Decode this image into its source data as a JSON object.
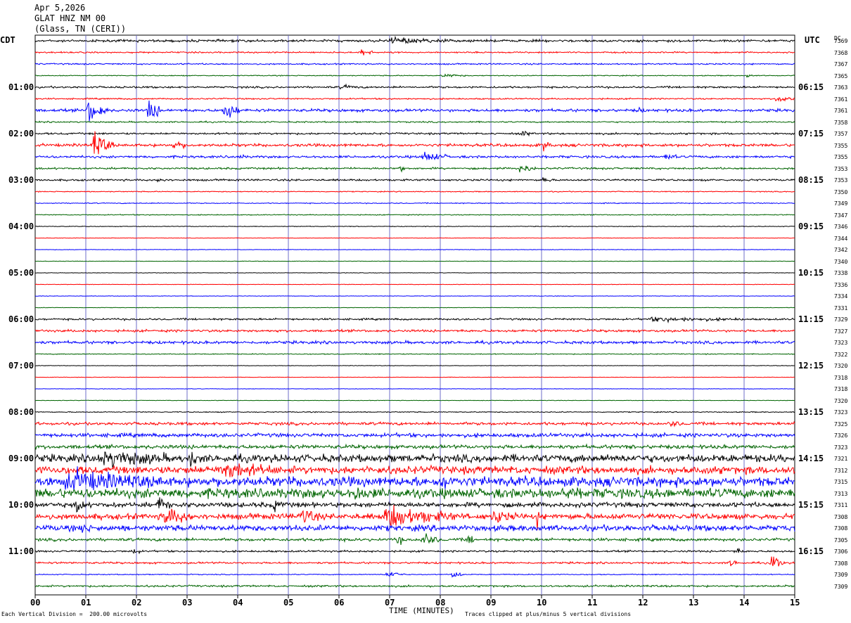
{
  "header": {
    "date": "Apr 5,2026",
    "station": "GLAT HNZ NM 00",
    "location": "(Glass, TN (CERI))"
  },
  "left_zone": "CDT",
  "right_zone": "UTC",
  "dc_label": "DC",
  "footer": {
    "scale_note": "Each Vertical Division =  200.00 microvolts",
    "xlabel": "TIME (MINUTES)",
    "clip_note": "Traces clipped at plus/minus 5 vertical divisions"
  },
  "colors": {
    "trace_cycle": [
      "#000000",
      "#ff0000",
      "#0000ff",
      "#006400"
    ],
    "grid": "#6e6ec8",
    "axis": "#000000"
  },
  "chart_data": {
    "type": "line",
    "title": "",
    "xlabel": "TIME (MINUTES)",
    "ylabel": "",
    "xlim": [
      0,
      15
    ],
    "x_ticks": [
      "00",
      "01",
      "02",
      "03",
      "04",
      "05",
      "06",
      "07",
      "08",
      "09",
      "10",
      "11",
      "12",
      "13",
      "14",
      "15"
    ],
    "trace_count": 48,
    "trace_duration_minutes": 15,
    "left_time_labels": [
      "01:00",
      "02:00",
      "03:00",
      "04:00",
      "05:00",
      "06:00",
      "07:00",
      "08:00",
      "09:00",
      "10:00",
      "11:00"
    ],
    "right_time_labels": [
      "06:15",
      "07:15",
      "08:15",
      "09:15",
      "10:15",
      "11:15",
      "12:15",
      "13:15",
      "14:15",
      "15:15",
      "16:15"
    ],
    "dc_offsets": [
      7369,
      7368,
      7367,
      7365,
      7363,
      7361,
      7361,
      7358,
      7357,
      7355,
      7355,
      7353,
      7353,
      7350,
      7349,
      7347,
      7346,
      7344,
      7342,
      7340,
      7338,
      7336,
      7334,
      7331,
      7329,
      7327,
      7323,
      7322,
      7320,
      7318,
      7318,
      7320,
      7323,
      7325,
      7326,
      7323,
      7321,
      7312,
      7315,
      7313,
      7311,
      7308,
      7308,
      7305,
      7306,
      7308,
      7309,
      7309
    ],
    "noise_level": [
      2.5,
      1.5,
      1.5,
      1,
      2,
      1.5,
      3,
      1.5,
      2,
      3,
      2.5,
      2,
      2,
      1,
      1,
      1,
      0.7,
      0.5,
      0.5,
      0.5,
      0.5,
      0.5,
      0.5,
      0.5,
      2,
      2.5,
      3,
      1,
      0.5,
      0.5,
      0.5,
      0.5,
      1,
      3,
      4,
      4,
      8,
      8,
      10,
      10,
      5,
      6,
      6,
      3,
      2,
      2,
      1,
      2
    ],
    "events": [
      {
        "trace": 0,
        "start": 6.9,
        "end": 8.2,
        "amp": 6
      },
      {
        "trace": 1,
        "start": 6.4,
        "end": 6.7,
        "amp": 8
      },
      {
        "trace": 3,
        "start": 8.0,
        "end": 8.5,
        "amp": 4
      },
      {
        "trace": 3,
        "start": 14.0,
        "end": 14.2,
        "amp": 5
      },
      {
        "trace": 4,
        "start": 6.0,
        "end": 6.4,
        "amp": 4
      },
      {
        "trace": 5,
        "start": 14.6,
        "end": 15.0,
        "amp": 10
      },
      {
        "trace": 6,
        "start": 1.0,
        "end": 1.45,
        "amp": 26
      },
      {
        "trace": 6,
        "start": 2.2,
        "end": 2.5,
        "amp": 28
      },
      {
        "trace": 6,
        "start": 3.7,
        "end": 4.05,
        "amp": 24
      },
      {
        "trace": 6,
        "start": 11.9,
        "end": 12.0,
        "amp": 10
      },
      {
        "trace": 8,
        "start": 9.6,
        "end": 9.8,
        "amp": 6
      },
      {
        "trace": 9,
        "start": 1.1,
        "end": 1.55,
        "amp": 30
      },
      {
        "trace": 9,
        "start": 2.7,
        "end": 3.0,
        "amp": 10
      },
      {
        "trace": 9,
        "start": 10.0,
        "end": 10.2,
        "amp": 12
      },
      {
        "trace": 10,
        "start": 4.0,
        "end": 4.15,
        "amp": 6
      },
      {
        "trace": 10,
        "start": 7.6,
        "end": 8.2,
        "amp": 10
      },
      {
        "trace": 10,
        "start": 12.4,
        "end": 12.7,
        "amp": 6
      },
      {
        "trace": 11,
        "start": 7.2,
        "end": 7.3,
        "amp": 16
      },
      {
        "trace": 11,
        "start": 9.5,
        "end": 9.9,
        "amp": 10
      },
      {
        "trace": 12,
        "start": 2.4,
        "end": 2.6,
        "amp": 6
      },
      {
        "trace": 12,
        "start": 10.0,
        "end": 10.2,
        "amp": 8
      },
      {
        "trace": 24,
        "start": 12.0,
        "end": 14.0,
        "amp": 4
      },
      {
        "trace": 33,
        "start": 12.5,
        "end": 12.8,
        "amp": 6
      },
      {
        "trace": 36,
        "start": 1.2,
        "end": 2.6,
        "amp": 14
      },
      {
        "trace": 36,
        "start": 3.0,
        "end": 3.3,
        "amp": 14
      },
      {
        "trace": 37,
        "start": 3.6,
        "end": 4.7,
        "amp": 14
      },
      {
        "trace": 38,
        "start": 0.5,
        "end": 2.5,
        "amp": 16
      },
      {
        "trace": 38,
        "start": 8.0,
        "end": 8.2,
        "amp": 24
      },
      {
        "trace": 39,
        "start": 6.3,
        "end": 6.6,
        "amp": 10
      },
      {
        "trace": 39,
        "start": 10.4,
        "end": 10.8,
        "amp": 8
      },
      {
        "trace": 40,
        "start": 0.8,
        "end": 1.0,
        "amp": 20
      },
      {
        "trace": 40,
        "start": 2.4,
        "end": 2.7,
        "amp": 16
      },
      {
        "trace": 40,
        "start": 4.7,
        "end": 4.9,
        "amp": 14
      },
      {
        "trace": 41,
        "start": 2.5,
        "end": 3.1,
        "amp": 18
      },
      {
        "trace": 41,
        "start": 5.2,
        "end": 5.6,
        "amp": 20
      },
      {
        "trace": 41,
        "start": 6.8,
        "end": 8.3,
        "amp": 20
      },
      {
        "trace": 41,
        "start": 9.0,
        "end": 9.5,
        "amp": 12
      },
      {
        "trace": 41,
        "start": 9.9,
        "end": 10.0,
        "amp": 20
      },
      {
        "trace": 42,
        "start": 0.9,
        "end": 1.1,
        "amp": 12
      },
      {
        "trace": 43,
        "start": 7.1,
        "end": 7.3,
        "amp": 14
      },
      {
        "trace": 43,
        "start": 7.6,
        "end": 8.0,
        "amp": 14
      },
      {
        "trace": 43,
        "start": 8.5,
        "end": 8.7,
        "amp": 12
      },
      {
        "trace": 44,
        "start": 1.9,
        "end": 2.1,
        "amp": 8
      },
      {
        "trace": 44,
        "start": 13.8,
        "end": 14.0,
        "amp": 8
      },
      {
        "trace": 45,
        "start": 13.7,
        "end": 13.9,
        "amp": 10
      },
      {
        "trace": 45,
        "start": 14.5,
        "end": 14.8,
        "amp": 18
      },
      {
        "trace": 46,
        "start": 6.9,
        "end": 7.3,
        "amp": 10
      },
      {
        "trace": 46,
        "start": 8.2,
        "end": 8.5,
        "amp": 8
      }
    ]
  }
}
